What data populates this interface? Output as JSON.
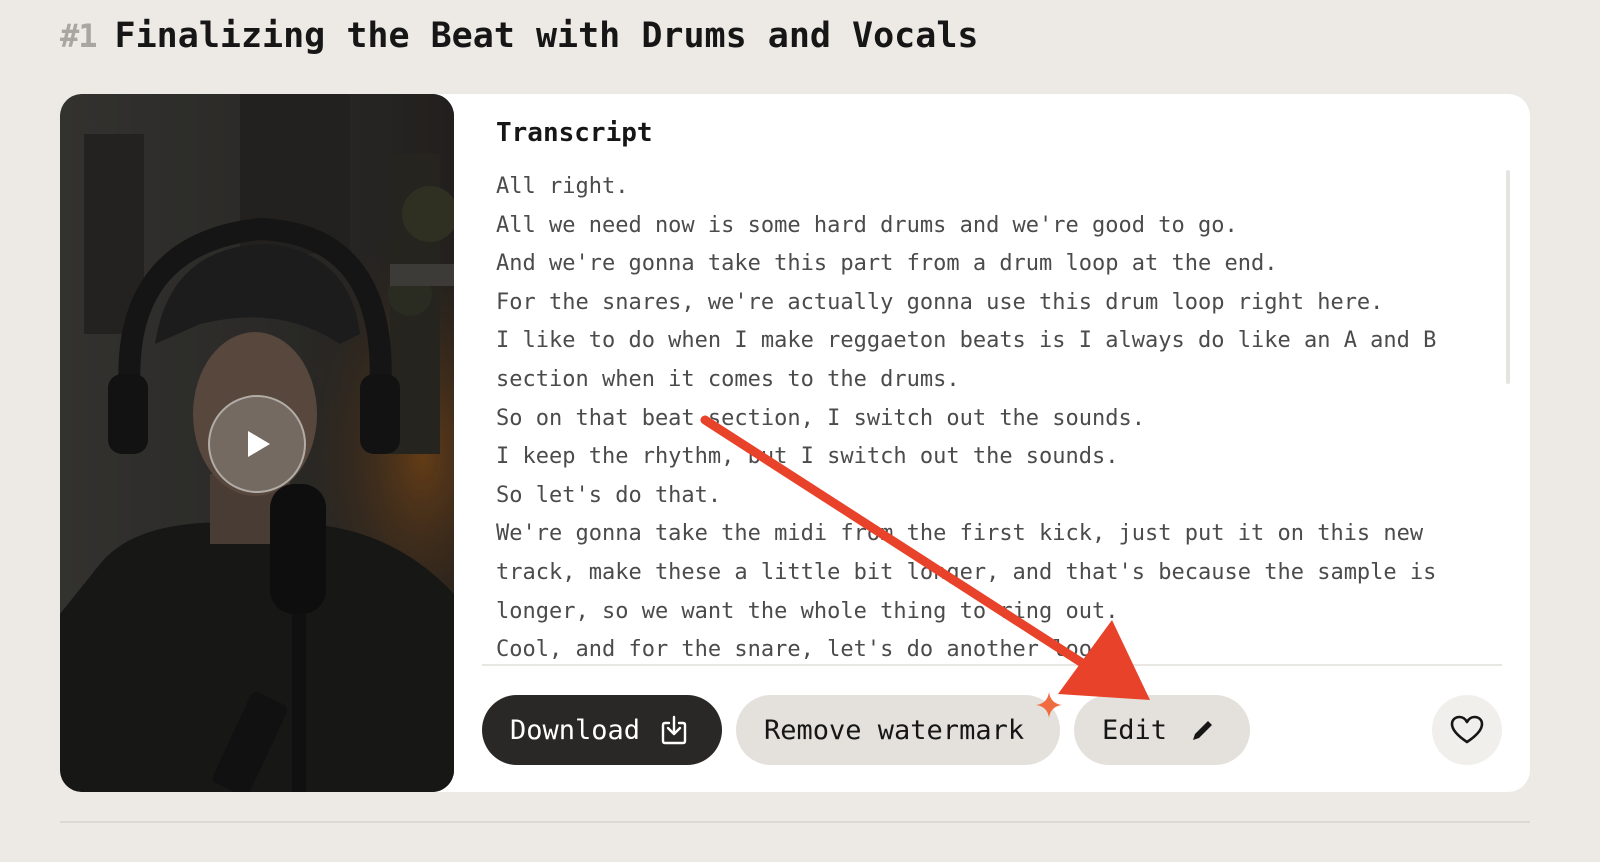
{
  "clip": {
    "rank": "#1",
    "title": "Finalizing the Beat with Drums and Vocals"
  },
  "transcript": {
    "heading": "Transcript",
    "lines": [
      "All right.",
      "All we need now is some hard drums and we're good to go.",
      "And we're gonna take this part from a drum loop at the end.",
      "For the snares, we're actually gonna use this drum loop right here.",
      "I like to do when I make reggaeton beats is I always do like an A and B section when it comes to the drums.",
      "So on that beat section, I switch out the sounds.",
      "I keep the rhythm, but I switch out the sounds.",
      "So let's do that.",
      "We're gonna take the midi from the first kick, just put it on this new track, make these a little bit longer, and that's because the sample is longer, so we want the whole thing to ring out.",
      "Cool, and for the snare, let's do another loop."
    ]
  },
  "actions": {
    "download_label": "Download",
    "remove_watermark_label": "Remove watermark",
    "edit_label": "Edit"
  },
  "icons": {
    "play": "play-icon",
    "download": "download-icon",
    "edit": "pencil-icon",
    "sparkle": "sparkle-icon",
    "like": "heart-icon"
  },
  "colors": {
    "annotation_arrow": "#e8432a",
    "sparkle": "#f06b3f",
    "download_bg": "#2a2826",
    "secondary_bg": "#e4e1dc"
  }
}
